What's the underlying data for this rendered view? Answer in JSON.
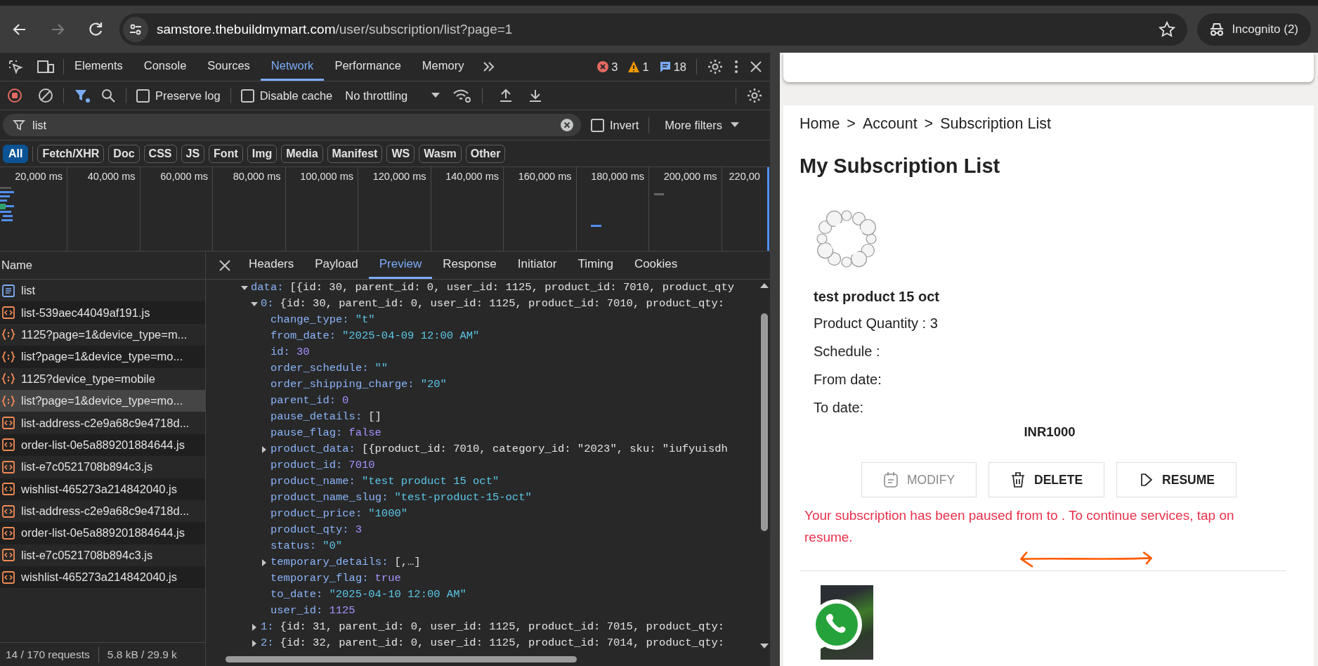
{
  "browser": {
    "forward_enabled": false,
    "url_host": "samstore.thebuildmymart.com",
    "url_path": "/user/subscription/list?page=1",
    "profile": "Incognito (2)"
  },
  "devtools": {
    "tabs": [
      {
        "label": "Elements",
        "selected": false
      },
      {
        "label": "Console",
        "selected": false
      },
      {
        "label": "Sources",
        "selected": false
      },
      {
        "label": "Network",
        "selected": true
      },
      {
        "label": "Performance",
        "selected": false
      },
      {
        "label": "Memory",
        "selected": false
      }
    ],
    "errors": "3",
    "warnings": "1",
    "messages": "18",
    "toolbar": {
      "preserve_log": {
        "label": "Preserve log",
        "checked": false
      },
      "disable_cache": {
        "label": "Disable cache",
        "checked": false
      },
      "throttling": "No throttling"
    },
    "filter": {
      "value": "list",
      "invert": {
        "label": "Invert",
        "checked": false
      },
      "more_filters": "More filters"
    },
    "type_filters": [
      {
        "label": "All",
        "selected": true
      },
      {
        "label": "Fetch/XHR",
        "selected": false
      },
      {
        "label": "Doc",
        "selected": false
      },
      {
        "label": "CSS",
        "selected": false
      },
      {
        "label": "JS",
        "selected": false
      },
      {
        "label": "Font",
        "selected": false
      },
      {
        "label": "Img",
        "selected": false
      },
      {
        "label": "Media",
        "selected": false
      },
      {
        "label": "Manifest",
        "selected": false
      },
      {
        "label": "WS",
        "selected": false
      },
      {
        "label": "Wasm",
        "selected": false
      },
      {
        "label": "Other",
        "selected": false
      }
    ],
    "timeline_ticks": [
      "20,000 ms",
      "40,000 ms",
      "60,000 ms",
      "80,000 ms",
      "100,000 ms",
      "120,000 ms",
      "140,000 ms",
      "160,000 ms",
      "180,000 ms",
      "200,000 ms",
      "220,00"
    ],
    "requests": {
      "header": "Name",
      "items": [
        {
          "name": "list",
          "kind": "document",
          "selected": false
        },
        {
          "name": "list-539aec44049af191.js",
          "kind": "script",
          "selected": false
        },
        {
          "name": "1125?page=1&device_type=m...",
          "kind": "fetch",
          "selected": false
        },
        {
          "name": "list?page=1&device_type=mo...",
          "kind": "fetch",
          "selected": false
        },
        {
          "name": "1125?device_type=mobile",
          "kind": "fetch",
          "selected": false
        },
        {
          "name": "list?page=1&device_type=mo...",
          "kind": "fetch",
          "selected": true
        },
        {
          "name": "list-address-c2e9a68c9e4718d...",
          "kind": "script",
          "selected": false
        },
        {
          "name": "order-list-0e5a889201884644.js",
          "kind": "script",
          "selected": false
        },
        {
          "name": "list-e7c0521708b894c3.js",
          "kind": "script",
          "selected": false
        },
        {
          "name": "wishlist-465273a214842040.js",
          "kind": "script",
          "selected": false
        },
        {
          "name": "list-address-c2e9a68c9e4718d...",
          "kind": "script",
          "selected": false
        },
        {
          "name": "order-list-0e5a889201884644.js",
          "kind": "script",
          "selected": false
        },
        {
          "name": "list-e7c0521708b894c3.js",
          "kind": "script",
          "selected": false
        },
        {
          "name": "wishlist-465273a214842040.js",
          "kind": "script",
          "selected": false
        }
      ]
    },
    "status": {
      "requests": "14 / 170 requests",
      "size": "5.8 kB / 29.9 k"
    },
    "detail_tabs": [
      {
        "label": "Headers",
        "selected": false
      },
      {
        "label": "Payload",
        "selected": false
      },
      {
        "label": "Preview",
        "selected": true
      },
      {
        "label": "Response",
        "selected": false
      },
      {
        "label": "Initiator",
        "selected": false
      },
      {
        "label": "Timing",
        "selected": false
      },
      {
        "label": "Cookies",
        "selected": false
      }
    ],
    "preview": [
      {
        "kind": "node",
        "key": "data:",
        "text": "[{id: 30, parent_id: 0, user_id: 1125, product_id: 7010, product_qty",
        "expanded": true,
        "children": [
          {
            "kind": "node",
            "key": "0:",
            "text": "{id: 30, parent_id: 0, user_id: 1125, product_id: 7010, product_qty:",
            "expanded": true,
            "children": [
              {
                "kind": "string",
                "key": "change_type:",
                "value": "\"t\""
              },
              {
                "kind": "string",
                "key": "from_date:",
                "value": "\"2025-04-09 12:00 AM\""
              },
              {
                "kind": "number",
                "key": "id:",
                "value": "30"
              },
              {
                "kind": "string",
                "key": "order_schedule:",
                "value": "\"\""
              },
              {
                "kind": "string",
                "key": "order_shipping_charge:",
                "value": "\"20\""
              },
              {
                "kind": "number",
                "key": "parent_id:",
                "value": "0"
              },
              {
                "kind": "plain",
                "key": "pause_details:",
                "value": "[]"
              },
              {
                "kind": "boolean",
                "key": "pause_flag:",
                "value": "false"
              },
              {
                "kind": "node",
                "key": "product_data:",
                "text": "[{product_id: 7010, category_id: \"2023\", sku: \"iufyuisdh",
                "expanded": false
              },
              {
                "kind": "number",
                "key": "product_id:",
                "value": "7010"
              },
              {
                "kind": "string",
                "key": "product_name:",
                "value": "\"test product 15 oct\""
              },
              {
                "kind": "string",
                "key": "product_name_slug:",
                "value": "\"test-product-15-oct\""
              },
              {
                "kind": "string",
                "key": "product_price:",
                "value": "\"1000\""
              },
              {
                "kind": "number",
                "key": "product_qty:",
                "value": "3"
              },
              {
                "kind": "string",
                "key": "status:",
                "value": "\"0\""
              },
              {
                "kind": "node",
                "key": "temporary_details:",
                "text": "[,…]",
                "expanded": false
              },
              {
                "kind": "boolean",
                "key": "temporary_flag:",
                "value": "true"
              },
              {
                "kind": "string",
                "key": "to_date:",
                "value": "\"2025-04-10 12:00 AM\""
              },
              {
                "kind": "number",
                "key": "user_id:",
                "value": "1125"
              }
            ]
          },
          {
            "kind": "node",
            "key": "1:",
            "text": "{id: 31, parent_id: 0, user_id: 1125, product_id: 7015, product_qty:",
            "expanded": false
          },
          {
            "kind": "node",
            "key": "2:",
            "text": "{id: 32, parent_id: 0, user_id: 1125, product_id: 7014, product_qty:",
            "expanded": false
          }
        ]
      }
    ]
  },
  "page": {
    "breadcrumb": [
      "Home",
      "Account",
      "Subscription List"
    ],
    "separator": ">",
    "heading": "My Subscription List",
    "subscription": {
      "name": "test product 15 oct",
      "fields": [
        "Product Quantity : 3",
        "Schedule :",
        "From date:",
        "To date:"
      ],
      "price": "INR1000",
      "actions": [
        {
          "label": "MODIFY",
          "kind": "modify",
          "disabled": true
        },
        {
          "label": "DELETE",
          "kind": "delete",
          "disabled": false
        },
        {
          "label": "RESUME",
          "kind": "resume",
          "disabled": false
        }
      ],
      "notice": "Your subscription has been paused from to . To continue services, tap on resume."
    }
  }
}
